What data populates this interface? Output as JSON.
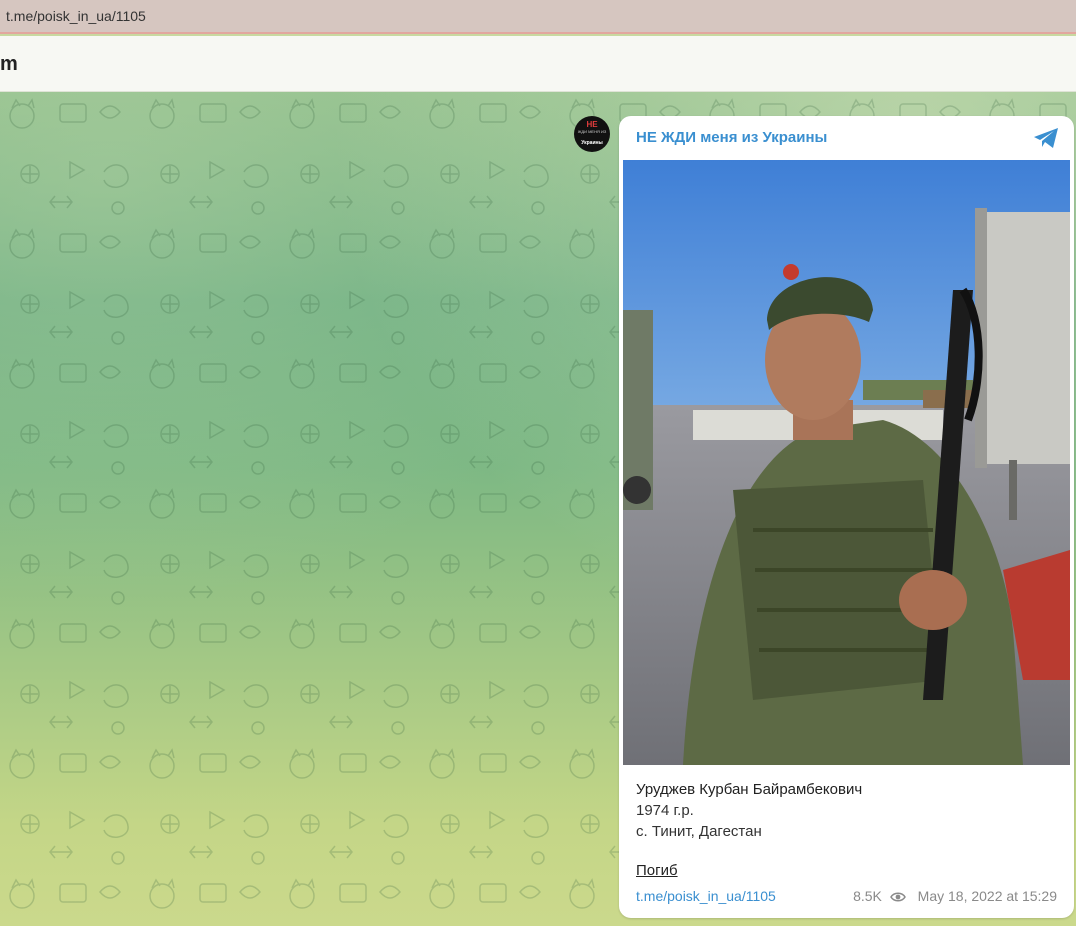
{
  "browser": {
    "url": "t.me/poisk_in_ua/1105"
  },
  "header": {
    "brand_fragment": "m"
  },
  "avatar": {
    "line1": "НЕ",
    "line2": "ЖДИ МЕНЯ ИЗ",
    "line3": "Украины"
  },
  "post": {
    "channel_name": "НЕ ЖДИ меня из Украины",
    "caption": {
      "name": "Уруджев Курбан Байрамбекович",
      "birth": "1974 г.р.",
      "place": "с. Тинит, Дагестан"
    },
    "status": "Погиб",
    "link": "t.me/poisk_in_ua/1105",
    "views": "8.5K",
    "date": "May 18, 2022 at 15:29"
  },
  "icons": {
    "channel_icon": "telegram-plane-icon",
    "views_icon": "eye-icon"
  },
  "colors": {
    "accent": "#3a8fd0",
    "url_border": "#e2a79f"
  }
}
